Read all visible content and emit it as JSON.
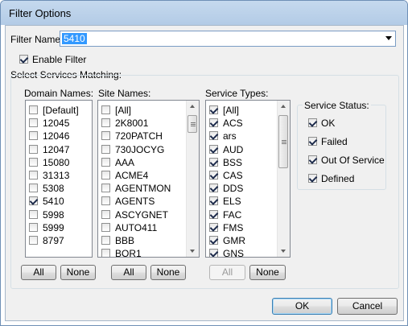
{
  "window": {
    "title": "Filter Options"
  },
  "filter": {
    "label": "Filter Name:",
    "value": "5410"
  },
  "enable_filter": {
    "label": "Enable Filter",
    "checked": true
  },
  "services_group": {
    "label": "Select Services Matching:"
  },
  "domain": {
    "label": "Domain Names:",
    "items": [
      {
        "label": "[Default]",
        "checked": false
      },
      {
        "label": "12045",
        "checked": false
      },
      {
        "label": "12046",
        "checked": false
      },
      {
        "label": "12047",
        "checked": false
      },
      {
        "label": "15080",
        "checked": false
      },
      {
        "label": "31313",
        "checked": false
      },
      {
        "label": "5308",
        "checked": false
      },
      {
        "label": "5410",
        "checked": true
      },
      {
        "label": "5998",
        "checked": false
      },
      {
        "label": "5999",
        "checked": false
      },
      {
        "label": "8797",
        "checked": false
      }
    ],
    "all_label": "All",
    "none_label": "None"
  },
  "site": {
    "label": "Site Names:",
    "items": [
      {
        "label": "[All]",
        "checked": false
      },
      {
        "label": "2K8001",
        "checked": false
      },
      {
        "label": "720PATCH",
        "checked": false
      },
      {
        "label": "730JOCYG",
        "checked": false
      },
      {
        "label": "AAA",
        "checked": false
      },
      {
        "label": "ACME4",
        "checked": false
      },
      {
        "label": "AGENTMON",
        "checked": false
      },
      {
        "label": "AGENTS",
        "checked": false
      },
      {
        "label": "ASCYGNET",
        "checked": false
      },
      {
        "label": "AUTO411",
        "checked": false
      },
      {
        "label": "BBB",
        "checked": false
      },
      {
        "label": "BOR1",
        "checked": false
      }
    ],
    "all_label": "All",
    "none_label": "None"
  },
  "service_types": {
    "label": "Service Types:",
    "items": [
      {
        "label": "[All]",
        "checked": true
      },
      {
        "label": "ACS",
        "checked": true
      },
      {
        "label": "ars",
        "checked": true
      },
      {
        "label": "AUD",
        "checked": true
      },
      {
        "label": "BSS",
        "checked": true
      },
      {
        "label": "CAS",
        "checked": true
      },
      {
        "label": "DDS",
        "checked": true
      },
      {
        "label": "ELS",
        "checked": true
      },
      {
        "label": "FAC",
        "checked": true
      },
      {
        "label": "FMS",
        "checked": true
      },
      {
        "label": "GMR",
        "checked": true
      },
      {
        "label": "GNS",
        "checked": true
      }
    ],
    "all_label": "All",
    "none_label": "None"
  },
  "service_status": {
    "label": "Service Status:",
    "items": [
      {
        "label": "OK",
        "checked": true
      },
      {
        "label": "Failed",
        "checked": true
      },
      {
        "label": "Out Of Service",
        "checked": true
      },
      {
        "label": "Defined",
        "checked": true
      }
    ]
  },
  "footer": {
    "ok_label": "OK",
    "cancel_label": "Cancel"
  }
}
